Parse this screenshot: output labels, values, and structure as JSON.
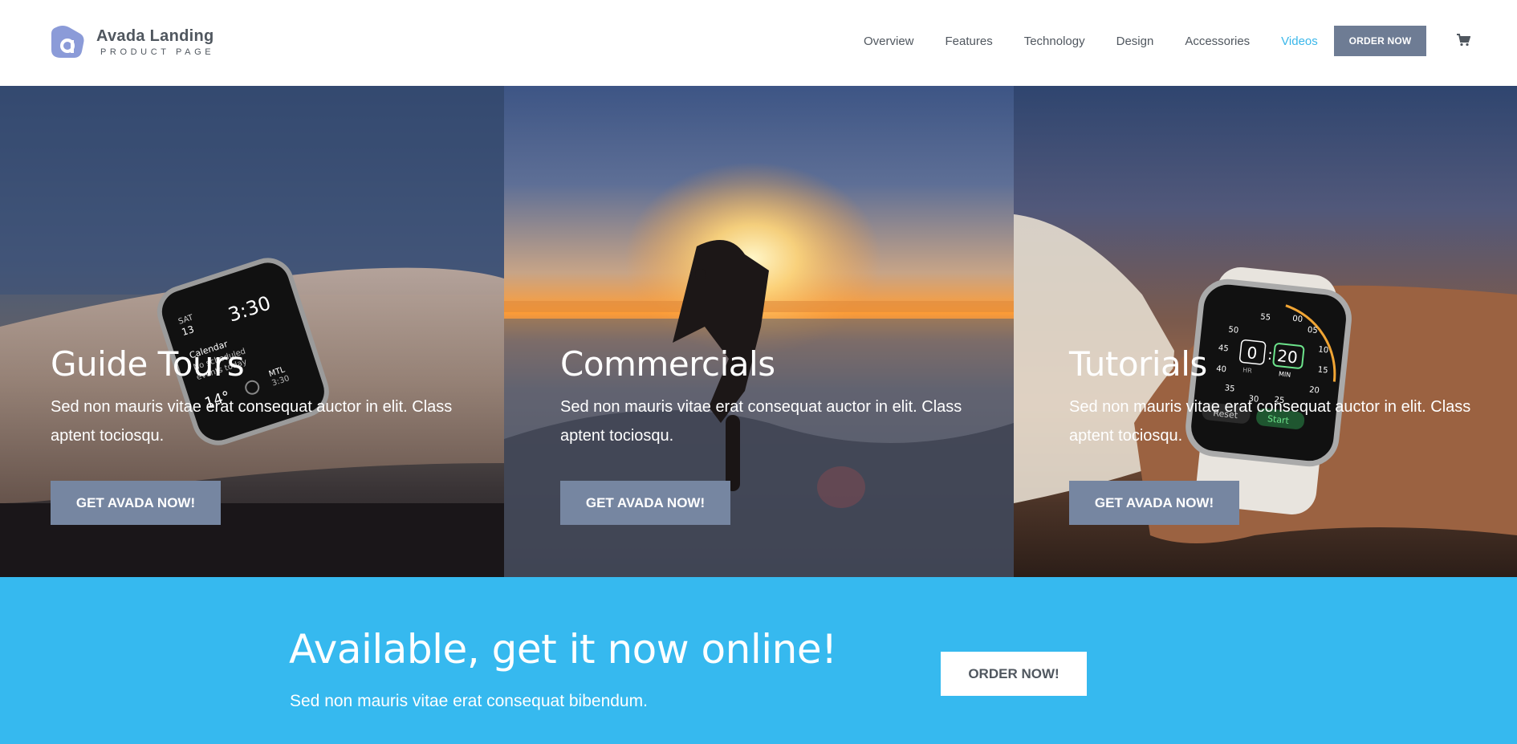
{
  "header": {
    "logo_title": "Avada Landing",
    "logo_subtitle": "PRODUCT PAGE",
    "nav": [
      {
        "label": "Overview"
      },
      {
        "label": "Features"
      },
      {
        "label": "Technology"
      },
      {
        "label": "Design"
      },
      {
        "label": "Accessories"
      },
      {
        "label": "Videos",
        "active": true
      }
    ],
    "order_button": "ORDER NOW",
    "cart_icon": "cart-icon"
  },
  "panels": [
    {
      "title": "Guide Tours",
      "text": "Sed non mauris vitae erat consequat auctor in elit. Class aptent tociosqu.",
      "button": "GET AVADA NOW!",
      "watch_time": "3:30",
      "watch_day": "SAT",
      "watch_date": "13",
      "watch_event": "Calendar",
      "watch_note1": "No scheduled",
      "watch_note2": "events today",
      "watch_temp": "14°",
      "watch_city": "MTL",
      "watch_city_time": "3:30"
    },
    {
      "title": "Commercials",
      "text": "Sed non mauris vitae erat consequat auctor in elit. Class aptent tociosqu.",
      "button": "GET AVADA NOW!"
    },
    {
      "title": "Tutorials",
      "text": "Sed non mauris vitae erat consequat auctor in elit. Class aptent tociosqu.",
      "button": "GET AVADA NOW!",
      "timer_hr": "0",
      "timer_min": "20",
      "timer_hr_label": "HR",
      "timer_min_label": "MIN",
      "timer_reset": "Reset",
      "timer_start": "Start"
    }
  ],
  "cta": {
    "title": "Available, get it now online!",
    "subtitle": "Sed non mauris vitae erat consequat bibendum.",
    "button": "ORDER NOW!"
  },
  "colors": {
    "accent": "#3ab7ea",
    "cta_band": "#36b9ef",
    "button": "#6e7c94",
    "text_dark": "#50575f"
  }
}
